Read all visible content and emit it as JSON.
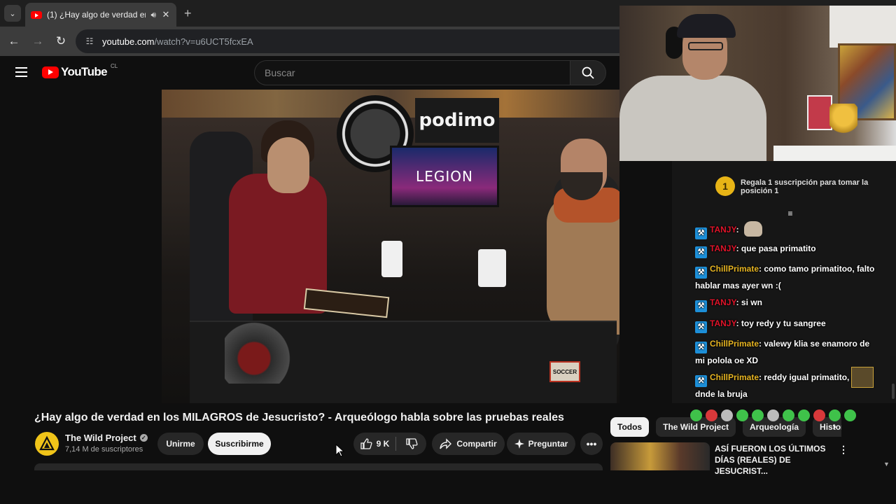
{
  "browser": {
    "tab_title": "(1) ¿Hay algo de verdad en",
    "url_host": "youtube.com",
    "url_path": "/watch?v=u6UCT5fcxEA"
  },
  "youtube": {
    "logo_text": "YouTube",
    "country_code": "CL",
    "search_placeholder": "Buscar"
  },
  "video": {
    "title": "¿Hay algo de verdad en los MILAGROS de Jesucristo? - Arqueólogo habla sobre las pruebas reales",
    "scene_podimo": "podimo",
    "scene_monitor": "LEGION",
    "scene_soccer": "SOCCER"
  },
  "channel": {
    "name": "The Wild Project",
    "subscribers": "7,14 M de suscriptores",
    "join_label": "Unirme",
    "subscribe_label": "Suscribirme"
  },
  "actions": {
    "likes": "9 K",
    "share_label": "Compartir",
    "ask_label": "Preguntar"
  },
  "chips": [
    "Todos",
    "The Wild Project",
    "Arqueología",
    "Historia"
  ],
  "related": {
    "title": "ASÍ FUERON LOS ÚLTIMOS DÍAS (REALES) DE JESUCRIST..."
  },
  "chat": {
    "top_rank": "1",
    "top_text": "Regala 1 suscripción para tomar la posición 1",
    "messages": [
      {
        "user": "TANJY",
        "user_color": "#e0142a",
        "text": ""
      },
      {
        "user": "TANJY",
        "user_color": "#e0142a",
        "text": "que pasa primatito"
      },
      {
        "user": "ChillPrimate",
        "user_color": "#e6b422",
        "text": "como tamo primatitoo, falto hablar mas ayer wn :("
      },
      {
        "user": "TANJY",
        "user_color": "#e0142a",
        "text": "si wn"
      },
      {
        "user": "TANJY",
        "user_color": "#e0142a",
        "text": "toy redy y tu sangree"
      },
      {
        "user": "ChillPrimate",
        "user_color": "#e6b422",
        "text": "valewy klia se enamoro de mi polola oe XD"
      },
      {
        "user": "ChillPrimate",
        "user_color": "#e6b422",
        "text": "reddy igual primatito, aqui dnde la bruja"
      }
    ]
  },
  "colors": {
    "youtube_red": "#ff0000",
    "chat_badge": "#1d8fd8",
    "rank_gold": "#e7b416"
  }
}
